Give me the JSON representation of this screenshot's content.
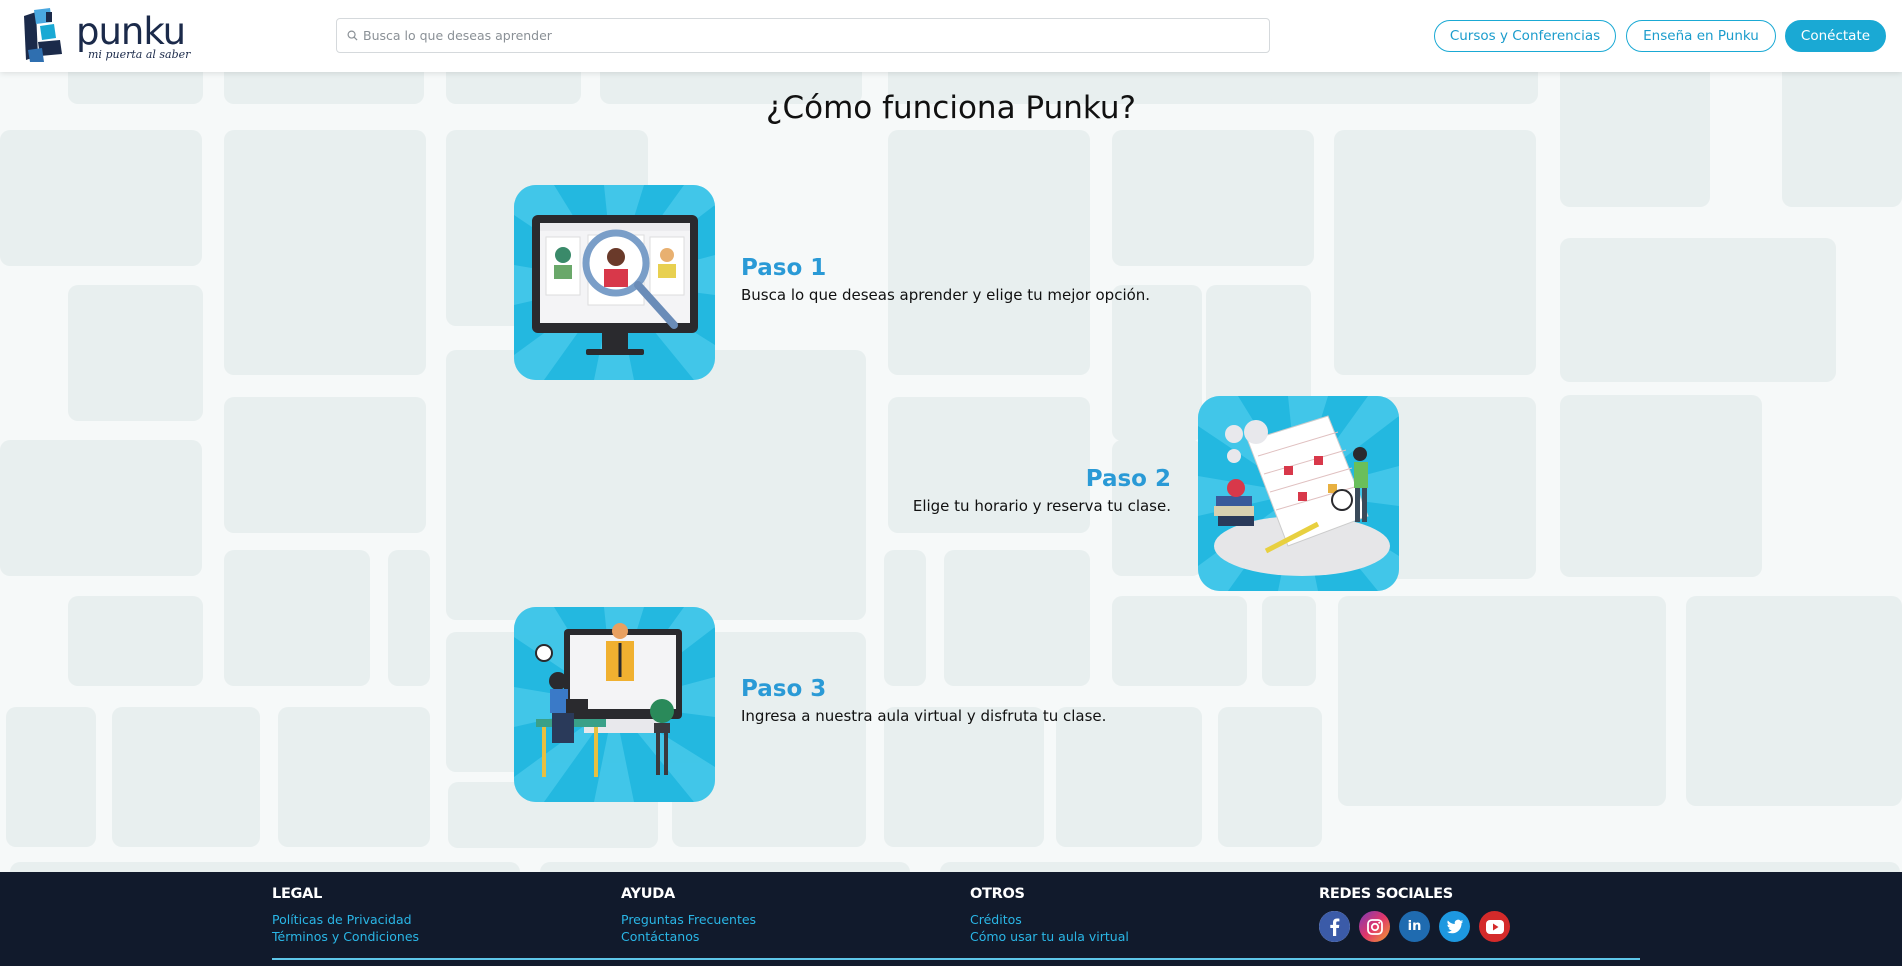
{
  "header": {
    "logo": {
      "name": "punku",
      "tagline": "mi puerta al saber"
    },
    "search": {
      "placeholder": "Busca lo que deseas aprender",
      "value": ""
    },
    "nav": {
      "courses_label": "Cursos y Conferencias",
      "teach_label": "Enseña en Punku",
      "login_label": "Conéctate"
    }
  },
  "main": {
    "title": "¿Cómo funciona Punku?",
    "steps": [
      {
        "heading": "Paso 1",
        "description": "Busca lo que deseas aprender y elige tu mejor opción."
      },
      {
        "heading": "Paso 2",
        "description": "Elige tu horario y reserva tu clase."
      },
      {
        "heading": "Paso 3",
        "description": "Ingresa a nuestra aula virtual y disfruta tu clase."
      }
    ]
  },
  "footer": {
    "legal": {
      "heading": "LEGAL",
      "links": [
        "Políticas de Privacidad",
        "Términos y Condiciones"
      ]
    },
    "help": {
      "heading": "AYUDA",
      "links": [
        "Preguntas Frecuentes",
        "Contáctanos"
      ]
    },
    "other": {
      "heading": "OTROS",
      "links": [
        "Créditos",
        "Cómo usar tu aula virtual"
      ]
    },
    "social": {
      "heading": "REDES SOCIALES",
      "icons": [
        "facebook-icon",
        "instagram-icon",
        "linkedin-icon",
        "twitter-icon",
        "youtube-icon"
      ]
    }
  },
  "colors": {
    "accent": "#1aa9d4",
    "step_heading": "#2a9ad6",
    "footer_bg": "#111a2c",
    "footer_link": "#2ab6e6",
    "tile_bg": "#e8efef"
  }
}
